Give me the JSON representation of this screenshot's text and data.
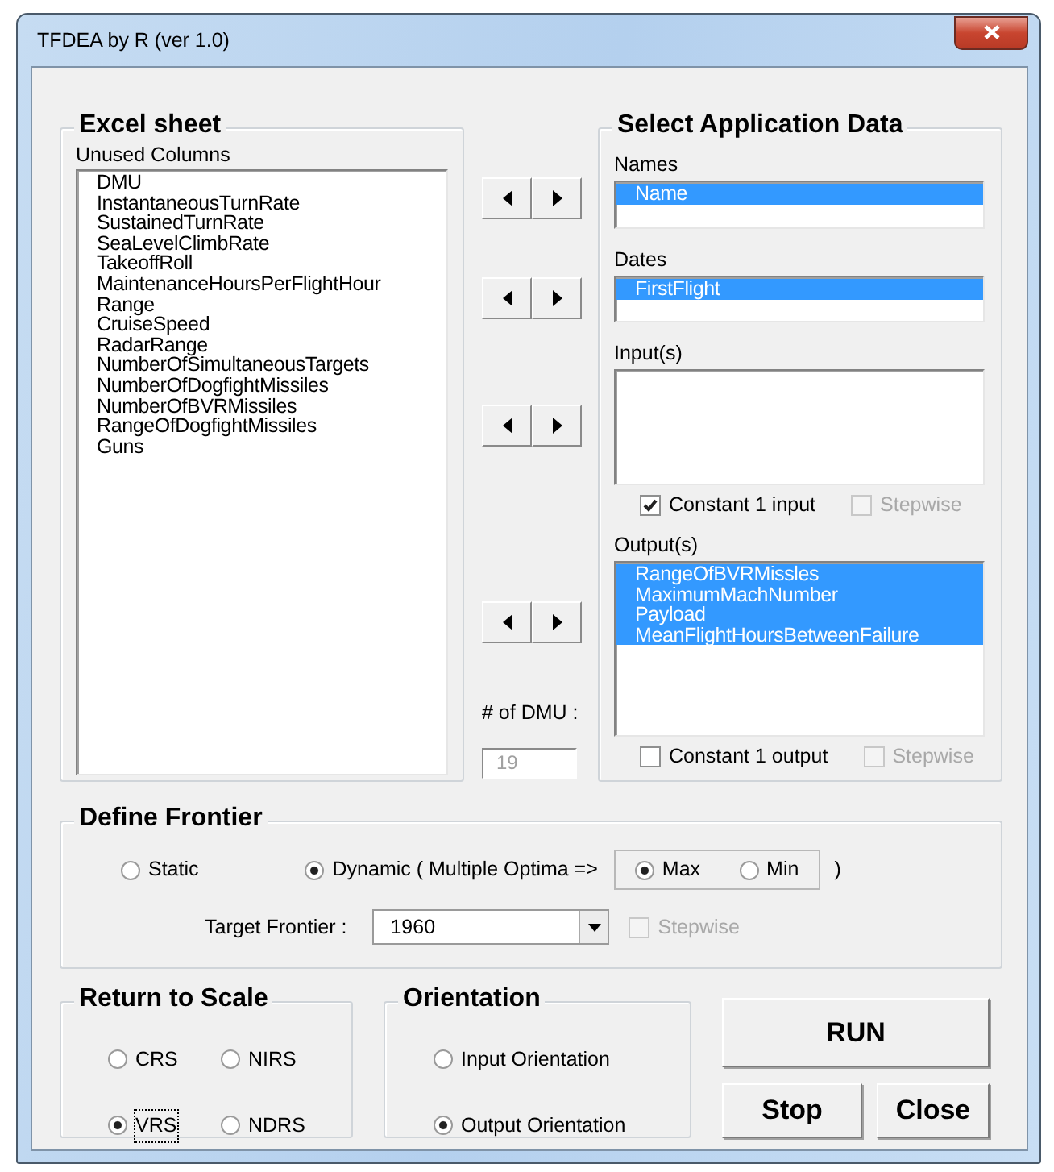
{
  "window": {
    "title": "TFDEA by R (ver 1.0)"
  },
  "excel_sheet": {
    "title": "Excel sheet",
    "list_label": "Unused Columns",
    "unused_columns": [
      {
        "label": "DMU",
        "selected": false
      },
      {
        "label": "InstantaneousTurnRate",
        "selected": false
      },
      {
        "label": "SustainedTurnRate",
        "selected": false
      },
      {
        "label": "SeaLevelClimbRate",
        "selected": false
      },
      {
        "label": "TakeoffRoll",
        "selected": false
      },
      {
        "label": "MaintenanceHoursPerFlightHour",
        "selected": false
      },
      {
        "label": "Range",
        "selected": false
      },
      {
        "label": "CruiseSpeed",
        "selected": false
      },
      {
        "label": "RadarRange",
        "selected": false
      },
      {
        "label": "NumberOfSimultaneousTargets",
        "selected": false
      },
      {
        "label": "NumberOfDogfightMissiles",
        "selected": false
      },
      {
        "label": "NumberOfBVRMissiles",
        "selected": false
      },
      {
        "label": "RangeOfDogfightMissiles",
        "selected": false
      },
      {
        "label": "Guns",
        "selected": false
      }
    ]
  },
  "dmu_count": {
    "label": "# of DMU :",
    "value": "19",
    "disabled": true
  },
  "application_data": {
    "title": "Select Application Data",
    "lists": [
      {
        "label": "Names",
        "items": [
          {
            "label": "Name",
            "selected": true
          }
        ]
      },
      {
        "label": "Dates",
        "items": [
          {
            "label": "FirstFlight",
            "selected": true
          }
        ]
      },
      {
        "label": "Input(s)",
        "options": [
          {
            "label": "Constant 1 input",
            "checked": true,
            "disabled": false
          },
          {
            "label": "Stepwise",
            "checked": false,
            "disabled": true
          }
        ]
      },
      {
        "label": "Output(s)",
        "items": [
          {
            "label": "RangeOfBVRMissles",
            "selected": true
          },
          {
            "label": "MaximumMachNumber",
            "selected": true
          },
          {
            "label": "Payload",
            "selected": true
          },
          {
            "label": "MeanFlightHoursBetweenFailure",
            "selected": true
          }
        ],
        "options": [
          {
            "label": "Constant 1 output",
            "checked": false,
            "disabled": false
          },
          {
            "label": "Stepwise",
            "checked": false,
            "disabled": true
          }
        ]
      }
    ]
  },
  "define_frontier": {
    "title": "Define Frontier",
    "modes": [
      {
        "label": "Static",
        "selected": false
      },
      {
        "label": "Dynamic ( Multiple Optima  =>",
        "selected": true
      }
    ],
    "optima": [
      {
        "label": "Max",
        "selected": true
      },
      {
        "label": "Min",
        "selected": false
      }
    ],
    "close_paren": ")",
    "target_label": "Target Frontier :",
    "target_value": "1960",
    "stepwise": {
      "label": "Stepwise",
      "checked": false,
      "disabled": true
    }
  },
  "return_to_scale": {
    "title": "Return to Scale",
    "options": [
      {
        "label": "CRS",
        "selected": false,
        "focused": false
      },
      {
        "label": "NIRS",
        "selected": false,
        "focused": false
      },
      {
        "label": "VRS",
        "selected": true,
        "focused": true
      },
      {
        "label": "NDRS",
        "selected": false,
        "focused": false
      }
    ]
  },
  "orientation": {
    "title": "Orientation",
    "options": [
      {
        "label": "Input Orientation",
        "selected": false
      },
      {
        "label": "Output Orientation",
        "selected": true
      }
    ]
  },
  "buttons": [
    {
      "label": "RUN"
    },
    {
      "label": "Stop"
    },
    {
      "label": "Close"
    }
  ]
}
